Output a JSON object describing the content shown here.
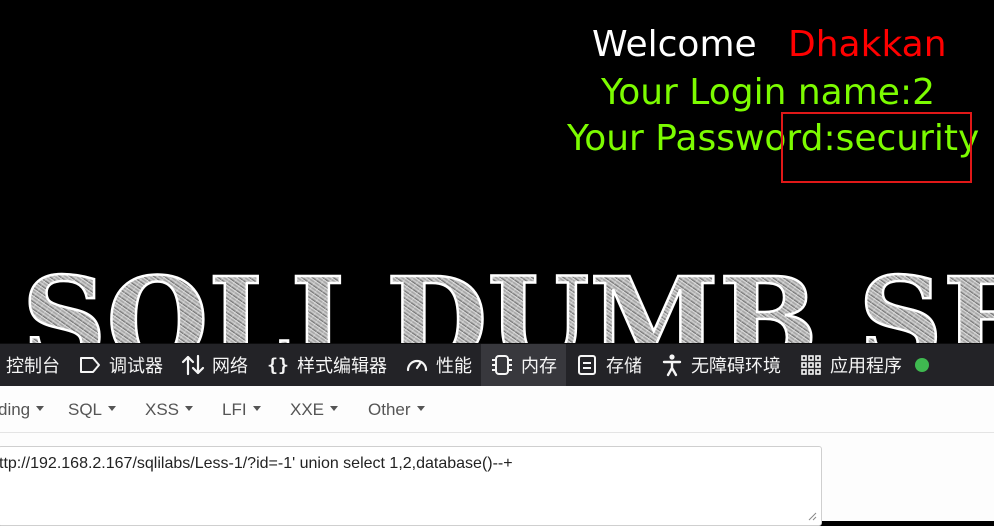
{
  "page": {
    "welcome_label": "Welcome",
    "welcome_name": "Dhakkan",
    "login_line": "Your Login name:2",
    "password_line": "Your Password:security",
    "banner_text": "SQLI DUMB SE"
  },
  "devtools": {
    "tabs": [
      {
        "label": "控制台",
        "icon": "console-icon"
      },
      {
        "label": "调试器",
        "icon": "debugger-icon"
      },
      {
        "label": "网络",
        "icon": "network-arrows-icon"
      },
      {
        "label": "样式编辑器",
        "icon": "braces-icon"
      },
      {
        "label": "性能",
        "icon": "gauge-icon"
      },
      {
        "label": "内存",
        "icon": "memory-chip-icon",
        "active": true
      },
      {
        "label": "存储",
        "icon": "storage-icon"
      },
      {
        "label": "无障碍环境",
        "icon": "accessibility-icon"
      },
      {
        "label": "应用程序",
        "icon": "apps-grid-icon"
      }
    ]
  },
  "hackbar": {
    "menu": [
      "ding",
      "SQL",
      "XSS",
      "LFI",
      "XXE",
      "Other"
    ],
    "url_value": "ttp://192.168.2.167/sqlilabs/Less-1/?id=-1' union select 1,2,database()--+"
  },
  "colors": {
    "welcome": "#ffffff",
    "name": "#ff0000",
    "info": "#7cfc00",
    "highlight": "#e01818",
    "devtools_bg": "#232327"
  }
}
